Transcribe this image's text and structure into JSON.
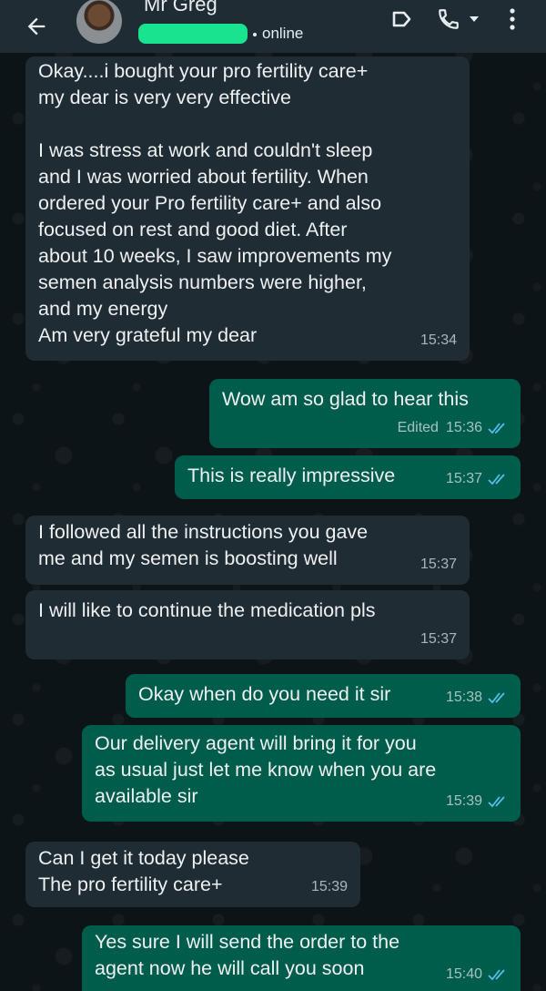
{
  "header": {
    "contact_name": "Mr Greg",
    "status": "online",
    "icons": [
      "back-arrow-icon",
      "video-call-icon",
      "voice-call-icon",
      "dropdown-icon",
      "more-options-icon"
    ]
  },
  "colors": {
    "header_bg": "#1f2c33",
    "incoming_bubble": "#1f2c34",
    "outgoing_bubble": "#005c4b",
    "read_tick": "#53bdeb",
    "redaction": "#18e48f"
  },
  "messages": [
    {
      "dir": "in",
      "text": "Okay....i bought your pro fertility care+\nmy dear is very very effective\n\nI was stress at work and couldn't  sleep\nand I was worried about fertility. When\nordered your Pro fertility care+  and also\nfocused on rest and good diet. After\nabout 10 weeks, I saw improvements  my\nsemen analysis numbers were higher,\nand my energy\nAm very grateful my dear",
      "time": "15:34"
    },
    {
      "dir": "out",
      "text": "Wow am so glad to hear this",
      "edited": "Edited",
      "time": "15:36"
    },
    {
      "dir": "out",
      "text": "This is really impressive",
      "time": "15:37"
    },
    {
      "dir": "in",
      "text": "I followed all the instructions you gave\nme and my semen is boosting well",
      "time": "15:37"
    },
    {
      "dir": "in",
      "text": "I will like to continue the medication pls",
      "time": "15:37"
    },
    {
      "dir": "out",
      "text": "Okay when do you need it sir",
      "time": "15:38"
    },
    {
      "dir": "out",
      "text": "Our delivery agent will bring it for you\nas usual just let me know when you are\navailable sir",
      "time": "15:39"
    },
    {
      "dir": "in",
      "text": "Can I get it today please\nThe pro fertility care+",
      "time": "15:39"
    },
    {
      "dir": "out",
      "text": "Yes sure I will send the order to the\nagent now he will call you soon",
      "time": "15:40"
    }
  ]
}
